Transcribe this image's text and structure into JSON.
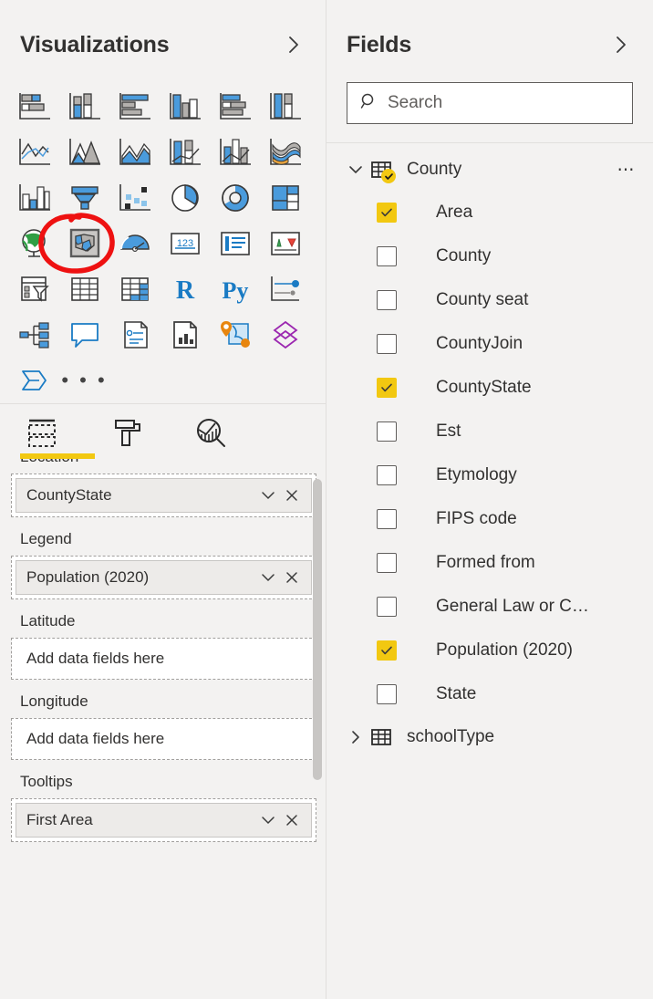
{
  "visualizations": {
    "title": "Visualizations",
    "collapse_icon": "chevron-right-icon",
    "gallery": [
      {
        "name": "stacked-bar-chart",
        "icon": "stacked-bar-chart-icon"
      },
      {
        "name": "stacked-column-chart",
        "icon": "stacked-column-chart-icon"
      },
      {
        "name": "clustered-bar-chart",
        "icon": "clustered-bar-chart-icon"
      },
      {
        "name": "clustered-column-chart",
        "icon": "clustered-column-chart-icon"
      },
      {
        "name": "100-percent-stacked-bar-chart",
        "icon": "pct-stacked-bar-chart-icon"
      },
      {
        "name": "100-percent-stacked-column-chart",
        "icon": "pct-stacked-column-chart-icon"
      },
      {
        "name": "line-chart",
        "icon": "line-chart-icon"
      },
      {
        "name": "area-chart",
        "icon": "area-chart-icon"
      },
      {
        "name": "stacked-area-chart",
        "icon": "stacked-area-chart-icon"
      },
      {
        "name": "line-and-stacked-column-chart",
        "icon": "line-stacked-column-icon"
      },
      {
        "name": "line-and-clustered-column-chart",
        "icon": "line-clustered-column-icon"
      },
      {
        "name": "ribbon-chart",
        "icon": "ribbon-chart-icon"
      },
      {
        "name": "waterfall-chart",
        "icon": "waterfall-chart-icon"
      },
      {
        "name": "funnel-chart",
        "icon": "funnel-chart-icon"
      },
      {
        "name": "scatter-chart",
        "icon": "scatter-chart-icon"
      },
      {
        "name": "pie-chart",
        "icon": "pie-chart-icon"
      },
      {
        "name": "donut-chart",
        "icon": "donut-chart-icon"
      },
      {
        "name": "treemap",
        "icon": "treemap-icon"
      },
      {
        "name": "map",
        "icon": "globe-map-icon"
      },
      {
        "name": "filled-map",
        "icon": "filled-map-icon",
        "selected": true
      },
      {
        "name": "gauge",
        "icon": "gauge-icon"
      },
      {
        "name": "card",
        "icon": "card-123-icon"
      },
      {
        "name": "multi-row-card",
        "icon": "multi-row-card-icon"
      },
      {
        "name": "kpi",
        "icon": "kpi-icon"
      },
      {
        "name": "slicer",
        "icon": "slicer-icon"
      },
      {
        "name": "table",
        "icon": "table-icon"
      },
      {
        "name": "matrix",
        "icon": "matrix-icon"
      },
      {
        "name": "r-script-visual",
        "icon": "r-script-icon",
        "glyph": "R"
      },
      {
        "name": "python-visual",
        "icon": "python-script-icon",
        "glyph": "Py"
      },
      {
        "name": "key-influencers",
        "icon": "key-influencers-icon"
      },
      {
        "name": "decomposition-tree",
        "icon": "decomposition-tree-icon"
      },
      {
        "name": "q-and-a",
        "icon": "qna-speech-bubble-icon"
      },
      {
        "name": "narrative",
        "icon": "smart-narrative-icon"
      },
      {
        "name": "paginated-report",
        "icon": "paginated-report-icon"
      },
      {
        "name": "azure-map",
        "icon": "azure-map-icon"
      },
      {
        "name": "power-apps",
        "icon": "power-apps-icon"
      },
      {
        "name": "power-automate",
        "icon": "power-automate-icon"
      },
      {
        "name": "more-visuals",
        "icon": "ellipsis-icon",
        "glyph": "• • •"
      }
    ],
    "tabs": [
      {
        "name": "tab-fields",
        "icon": "fields-table-icon",
        "active": true
      },
      {
        "name": "tab-format",
        "icon": "paint-roller-icon",
        "active": false
      },
      {
        "name": "tab-analytics",
        "icon": "analytics-magnifier-icon",
        "active": false
      }
    ],
    "wells": [
      {
        "label": "Location",
        "clipped": true,
        "chip": "CountyState",
        "placeholder": null
      },
      {
        "label": "Legend",
        "clipped": false,
        "chip": "Population (2020)",
        "placeholder": null
      },
      {
        "label": "Latitude",
        "clipped": false,
        "chip": null,
        "placeholder": "Add data fields here"
      },
      {
        "label": "Longitude",
        "clipped": false,
        "chip": null,
        "placeholder": "Add data fields here"
      },
      {
        "label": "Tooltips",
        "clipped": false,
        "chip": "First Area",
        "placeholder": null
      }
    ],
    "chip_dropdown_icon": "chevron-down-icon",
    "chip_remove_icon": "close-x-icon"
  },
  "fields": {
    "title": "Fields",
    "collapse_icon": "chevron-right-icon",
    "search": {
      "placeholder": "Search",
      "value": "",
      "icon": "search-icon"
    },
    "tables": [
      {
        "name": "County",
        "expanded": true,
        "expand_icon": "chevron-down-icon",
        "table_icon": "table-grid-icon",
        "has_badge": true,
        "badge_icon": "check-icon",
        "menu_icon": "ellipsis-icon",
        "columns": [
          {
            "label": "Area",
            "checked": true
          },
          {
            "label": "County",
            "checked": false
          },
          {
            "label": "County seat",
            "checked": false
          },
          {
            "label": "CountyJoin",
            "checked": false
          },
          {
            "label": "CountyState",
            "checked": true
          },
          {
            "label": "Est",
            "checked": false
          },
          {
            "label": "Etymology",
            "checked": false
          },
          {
            "label": "FIPS code",
            "checked": false
          },
          {
            "label": "Formed from",
            "checked": false
          },
          {
            "label": "General Law or C…",
            "checked": false
          },
          {
            "label": "Population (2020)",
            "checked": true
          },
          {
            "label": "State",
            "checked": false
          }
        ]
      },
      {
        "name": "schoolType",
        "expanded": false,
        "expand_icon": "chevron-right-icon",
        "table_icon": "table-grid-icon",
        "has_badge": false,
        "menu_icon": null,
        "columns": []
      }
    ]
  },
  "annotation": {
    "name": "red-circle-highlight",
    "color": "#ee1111",
    "target": "filled-map"
  },
  "colors": {
    "panel_background": "#f3f2f1",
    "accent_yellow": "#f2c811",
    "text_primary": "#323130",
    "border": "#e1dfdd",
    "chart_blue": "#4a9bdc",
    "chart_gray": "#b3b0ad"
  }
}
